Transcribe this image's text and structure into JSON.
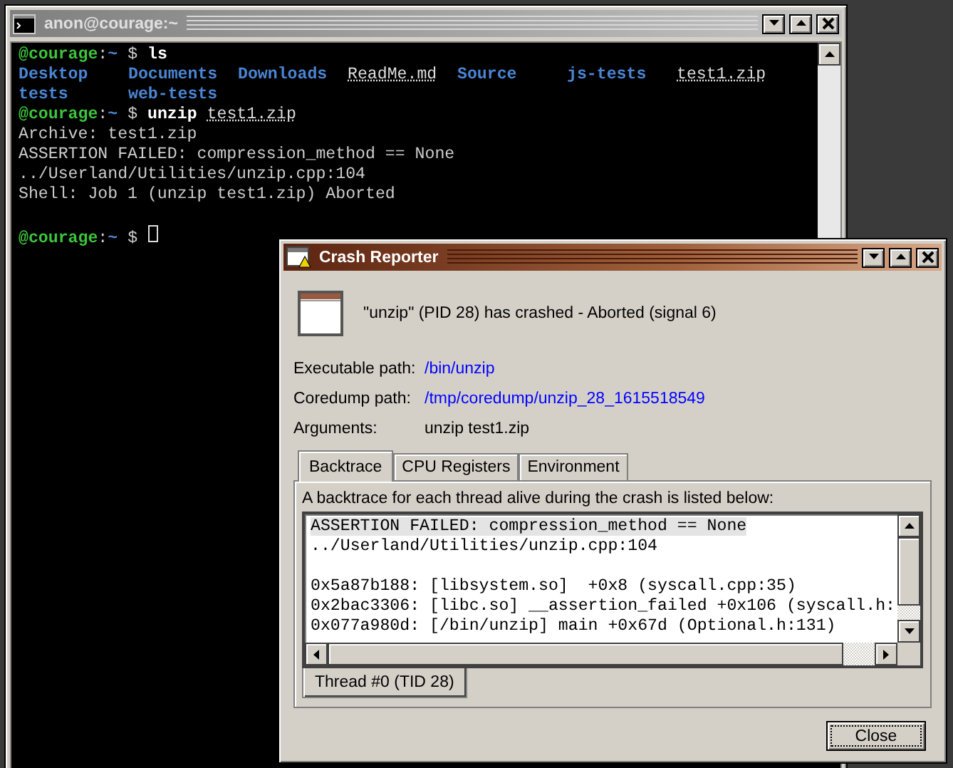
{
  "terminal": {
    "title": "anon@courage:~",
    "lines": [
      {
        "kind": "prompt",
        "user": "@courage",
        "separator": ":",
        "path": "~",
        "symbol": "$",
        "command": "ls"
      },
      {
        "kind": "listing",
        "entries": [
          {
            "name": "Desktop",
            "kind": "dir"
          },
          {
            "name": "Documents",
            "kind": "dir"
          },
          {
            "name": "Downloads",
            "kind": "dir"
          },
          {
            "name": "ReadMe.md",
            "kind": "file"
          },
          {
            "name": "Source",
            "kind": "dir"
          },
          {
            "name": "js-tests",
            "kind": "dir"
          },
          {
            "name": "test1.zip",
            "kind": "file"
          },
          {
            "name": "tests",
            "kind": "dir"
          },
          {
            "name": "web-tests",
            "kind": "dir"
          }
        ]
      },
      {
        "kind": "prompt",
        "user": "@courage",
        "separator": ":",
        "path": "~",
        "symbol": "$",
        "command": "unzip",
        "argument": "test1.zip"
      },
      {
        "kind": "output",
        "text": "Archive: test1.zip"
      },
      {
        "kind": "output",
        "text": "ASSERTION FAILED: compression_method == None"
      },
      {
        "kind": "output",
        "text": "../Userland/Utilities/unzip.cpp:104"
      },
      {
        "kind": "output",
        "text": "Shell: Job 1 (unzip test1.zip) Aborted"
      },
      {
        "kind": "blank"
      },
      {
        "kind": "prompt",
        "user": "@courage",
        "separator": ":",
        "path": "~",
        "symbol": "$",
        "cursor": true
      }
    ]
  },
  "crash_reporter": {
    "title": "Crash Reporter",
    "message": "\"unzip\" (PID 28) has crashed - Aborted (signal 6)",
    "fields": [
      {
        "label": "Executable path:",
        "value": "/bin/unzip",
        "kind": "link"
      },
      {
        "label": "Coredump path:",
        "value": "/tmp/coredump/unzip_28_1615518549",
        "kind": "link"
      },
      {
        "label": "Arguments:",
        "value": "unzip test1.zip",
        "kind": "plain"
      }
    ],
    "tabs": [
      {
        "label": "Backtrace",
        "selected": true
      },
      {
        "label": "CPU Registers",
        "selected": false
      },
      {
        "label": "Environment",
        "selected": false
      }
    ],
    "description": "A backtrace for each thread alive during the crash is listed below:",
    "backtrace_blocks": [
      [
        {
          "text": "ASSERTION FAILED: compression_method == None",
          "selected": true
        },
        {
          "text": "../Userland/Utilities/unzip.cpp:104",
          "selected": false
        }
      ],
      [
        {
          "text": "0x5a87b188: [libsystem.so]  +0x8 (syscall.cpp:35)",
          "selected": false
        },
        {
          "text": "0x2bac3306: [libc.so] __assertion_failed +0x106 (syscall.h:",
          "selected": false
        },
        {
          "text": "0x077a980d: [/bin/unzip] main +0x67d (Optional.h:131)",
          "selected": false
        }
      ]
    ],
    "thread_tabs": [
      {
        "label": "Thread #0 (TID 28)",
        "selected": true
      }
    ],
    "buttons": [
      "Close"
    ]
  }
}
